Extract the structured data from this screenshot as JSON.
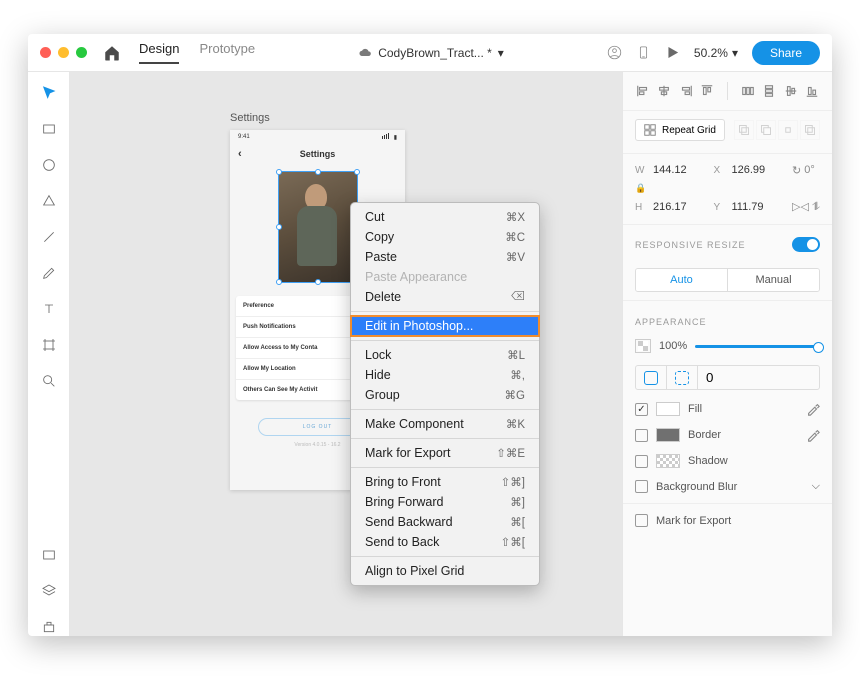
{
  "titlebar": {
    "tab_design": "Design",
    "tab_prototype": "Prototype",
    "doc_title": "CodyBrown_Tract... *",
    "zoom": "50.2%",
    "share": "Share"
  },
  "artboard": {
    "label": "Settings",
    "time": "9:41",
    "title": "Settings",
    "rows": [
      "Preference",
      "Push Notifications",
      "Allow Access to My Conta",
      "Allow My Location",
      "Others Can See My Activit"
    ],
    "logout": "LOG OUT",
    "version": "Version 4.0.15 - 16.2"
  },
  "context_menu": [
    {
      "label": "Cut",
      "shortcut": "⌘X"
    },
    {
      "label": "Copy",
      "shortcut": "⌘C"
    },
    {
      "label": "Paste",
      "shortcut": "⌘V"
    },
    {
      "label": "Paste Appearance",
      "shortcut": "",
      "disabled": true
    },
    {
      "label": "Delete",
      "shortcut": "",
      "icon": "del"
    },
    {
      "sep": true
    },
    {
      "label": "Edit in Photoshop...",
      "shortcut": "",
      "hl": true
    },
    {
      "sep": true
    },
    {
      "label": "Lock",
      "shortcut": "⌘L"
    },
    {
      "label": "Hide",
      "shortcut": "⌘,"
    },
    {
      "label": "Group",
      "shortcut": "⌘G"
    },
    {
      "sep": true
    },
    {
      "label": "Make Component",
      "shortcut": "⌘K"
    },
    {
      "sep": true
    },
    {
      "label": "Mark for Export",
      "shortcut": "⇧⌘E"
    },
    {
      "sep": true
    },
    {
      "label": "Bring to Front",
      "shortcut": "⇧⌘]"
    },
    {
      "label": "Bring Forward",
      "shortcut": "⌘]"
    },
    {
      "label": "Send Backward",
      "shortcut": "⌘["
    },
    {
      "label": "Send to Back",
      "shortcut": "⇧⌘["
    },
    {
      "sep": true
    },
    {
      "label": "Align to Pixel Grid",
      "shortcut": ""
    }
  ],
  "panel": {
    "repeat_grid": "Repeat Grid",
    "w": "144.12",
    "x": "126.99",
    "rotation": "0°",
    "h": "216.17",
    "y": "111.79",
    "responsive": "RESPONSIVE RESIZE",
    "auto": "Auto",
    "manual": "Manual",
    "appearance": "APPEARANCE",
    "opacity": "100%",
    "radius": "0",
    "fill": "Fill",
    "border": "Border",
    "shadow": "Shadow",
    "bg_blur": "Background Blur",
    "mark_export": "Mark for Export",
    "colors": {
      "accent": "#1592e6",
      "fill": "#ffffff",
      "border": "#707070"
    }
  }
}
